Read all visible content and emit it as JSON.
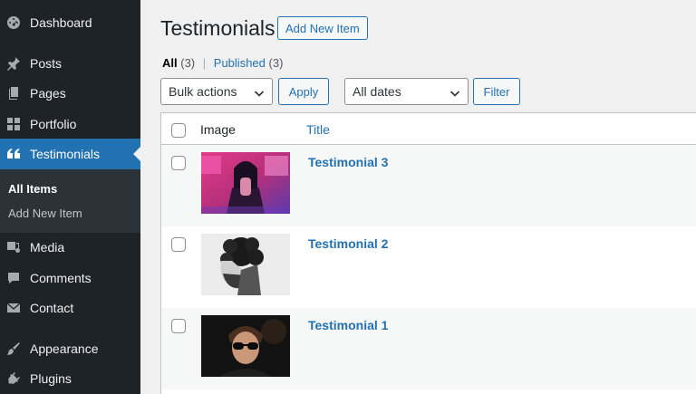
{
  "sidebar": {
    "items": [
      {
        "label": "Dashboard",
        "icon": "dashboard-icon"
      },
      {
        "label": "Posts",
        "icon": "pin-icon"
      },
      {
        "label": "Pages",
        "icon": "pages-icon"
      },
      {
        "label": "Portfolio",
        "icon": "grid-icon"
      },
      {
        "label": "Testimonials",
        "icon": "quote-icon"
      },
      {
        "label": "Media",
        "icon": "media-icon"
      },
      {
        "label": "Comments",
        "icon": "comment-icon"
      },
      {
        "label": "Contact",
        "icon": "mail-icon"
      },
      {
        "label": "Appearance",
        "icon": "brush-icon"
      },
      {
        "label": "Plugins",
        "icon": "plugin-icon"
      }
    ],
    "submenu": {
      "current": "All Items",
      "other": "Add New Item"
    }
  },
  "header": {
    "title": "Testimonials",
    "add_new_label": "Add New Item"
  },
  "filters": {
    "all_label": "All",
    "all_count": "(3)",
    "separator": "|",
    "published_label": "Published",
    "published_count": "(3)",
    "bulk_actions": "Bulk actions",
    "apply_label": "Apply",
    "dates": "All dates",
    "filter_label": "Filter"
  },
  "table": {
    "columns": [
      "Image",
      "Title"
    ],
    "rows": [
      {
        "title": "Testimonial 3",
        "image": "neon-portrait"
      },
      {
        "title": "Testimonial 2",
        "image": "curly-hair-portrait"
      },
      {
        "title": "Testimonial 1",
        "image": "sunglasses-portrait"
      }
    ]
  },
  "colors": {
    "sidebar_bg": "#1d2327",
    "accent": "#2271b1",
    "page_bg": "#f0f0f1"
  }
}
